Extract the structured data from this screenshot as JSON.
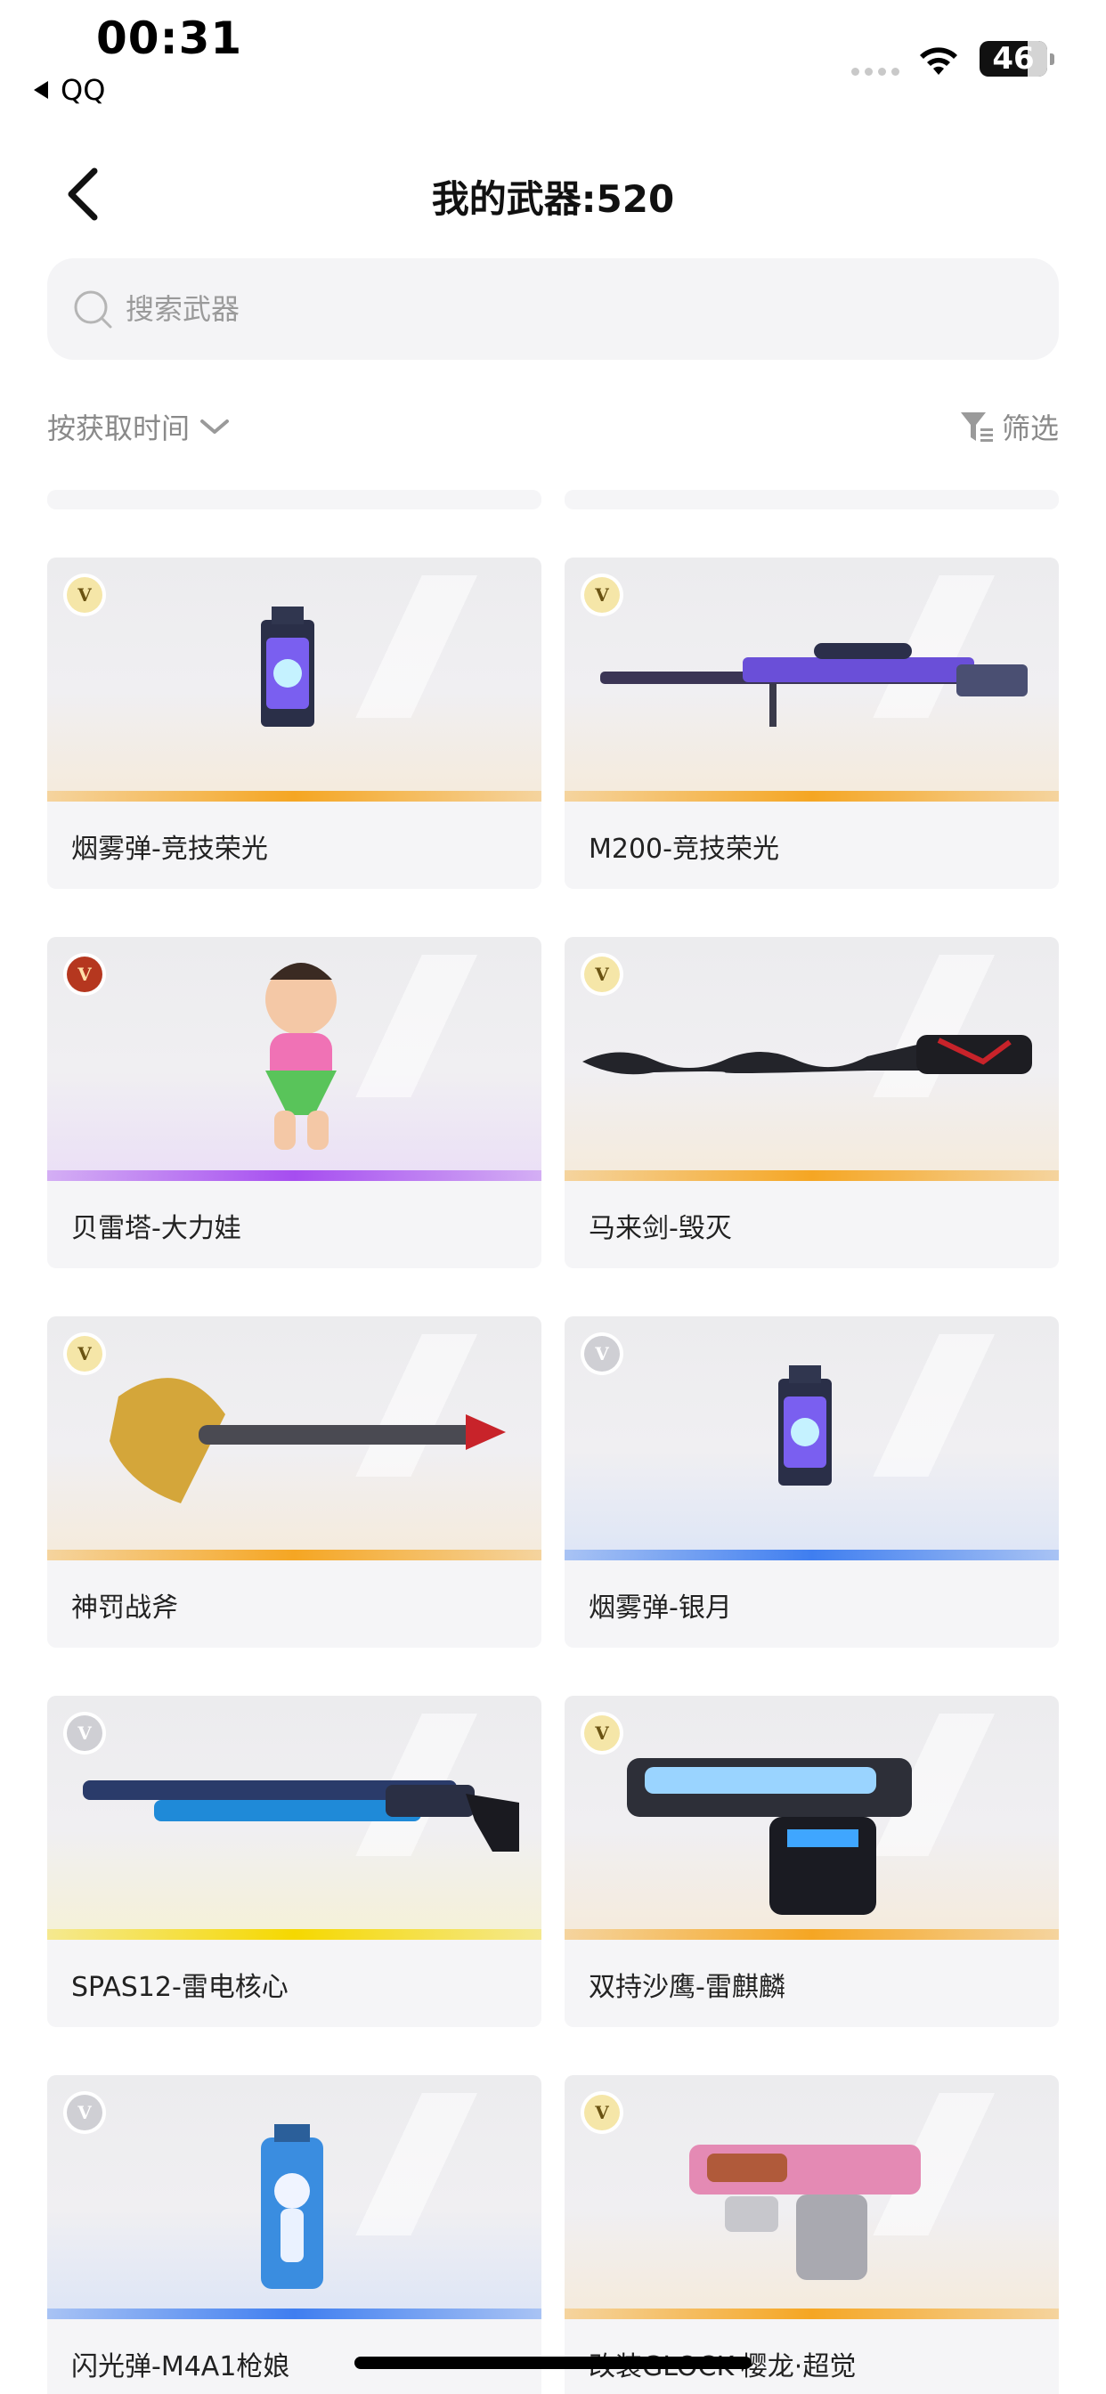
{
  "status_bar": {
    "time": "00:31",
    "back_app": "QQ",
    "battery": "46"
  },
  "header": {
    "title": "我的武器:520"
  },
  "search": {
    "placeholder": "搜索武器",
    "value": ""
  },
  "toolbar": {
    "sort_label": "按获取时间",
    "filter_label": "筛选"
  },
  "colors": {
    "gold": "#f5a623",
    "purple": "#a64df0",
    "blue": "#3f7ef0",
    "yellow": "#f5d800",
    "card_bg": "#f5f5f7"
  },
  "weapons": [
    {
      "name": "烟雾弹-竞技荣光",
      "rarity": "gold",
      "badge": "V",
      "icon": "smoke-grenade-icon"
    },
    {
      "name": "M200-竞技荣光",
      "rarity": "gold",
      "badge": "V",
      "icon": "sniper-rifle-icon"
    },
    {
      "name": "贝雷塔-大力娃",
      "rarity": "purple",
      "badge": "V",
      "icon": "calabash-kid-icon"
    },
    {
      "name": "马来剑-毁灭",
      "rarity": "gold",
      "badge": "V",
      "icon": "kris-sword-icon"
    },
    {
      "name": "神罚战斧",
      "rarity": "gold",
      "badge": "V",
      "icon": "battle-axe-icon"
    },
    {
      "name": "烟雾弹-银月",
      "rarity": "blue",
      "badge": "",
      "icon": "smoke-grenade-icon"
    },
    {
      "name": "SPAS12-雷电核心",
      "rarity": "yellow",
      "badge": "V",
      "icon": "shotgun-icon"
    },
    {
      "name": "双持沙鹰-雷麒麟",
      "rarity": "gold",
      "badge": "V",
      "icon": "pistol-icon"
    },
    {
      "name": "闪光弹-M4A1枪娘",
      "rarity": "blue",
      "badge": "",
      "icon": "flash-grenade-icon"
    },
    {
      "name": "改装GLOCK-樱龙·超觉",
      "rarity": "gold",
      "badge": "V",
      "icon": "glock-icon"
    }
  ]
}
